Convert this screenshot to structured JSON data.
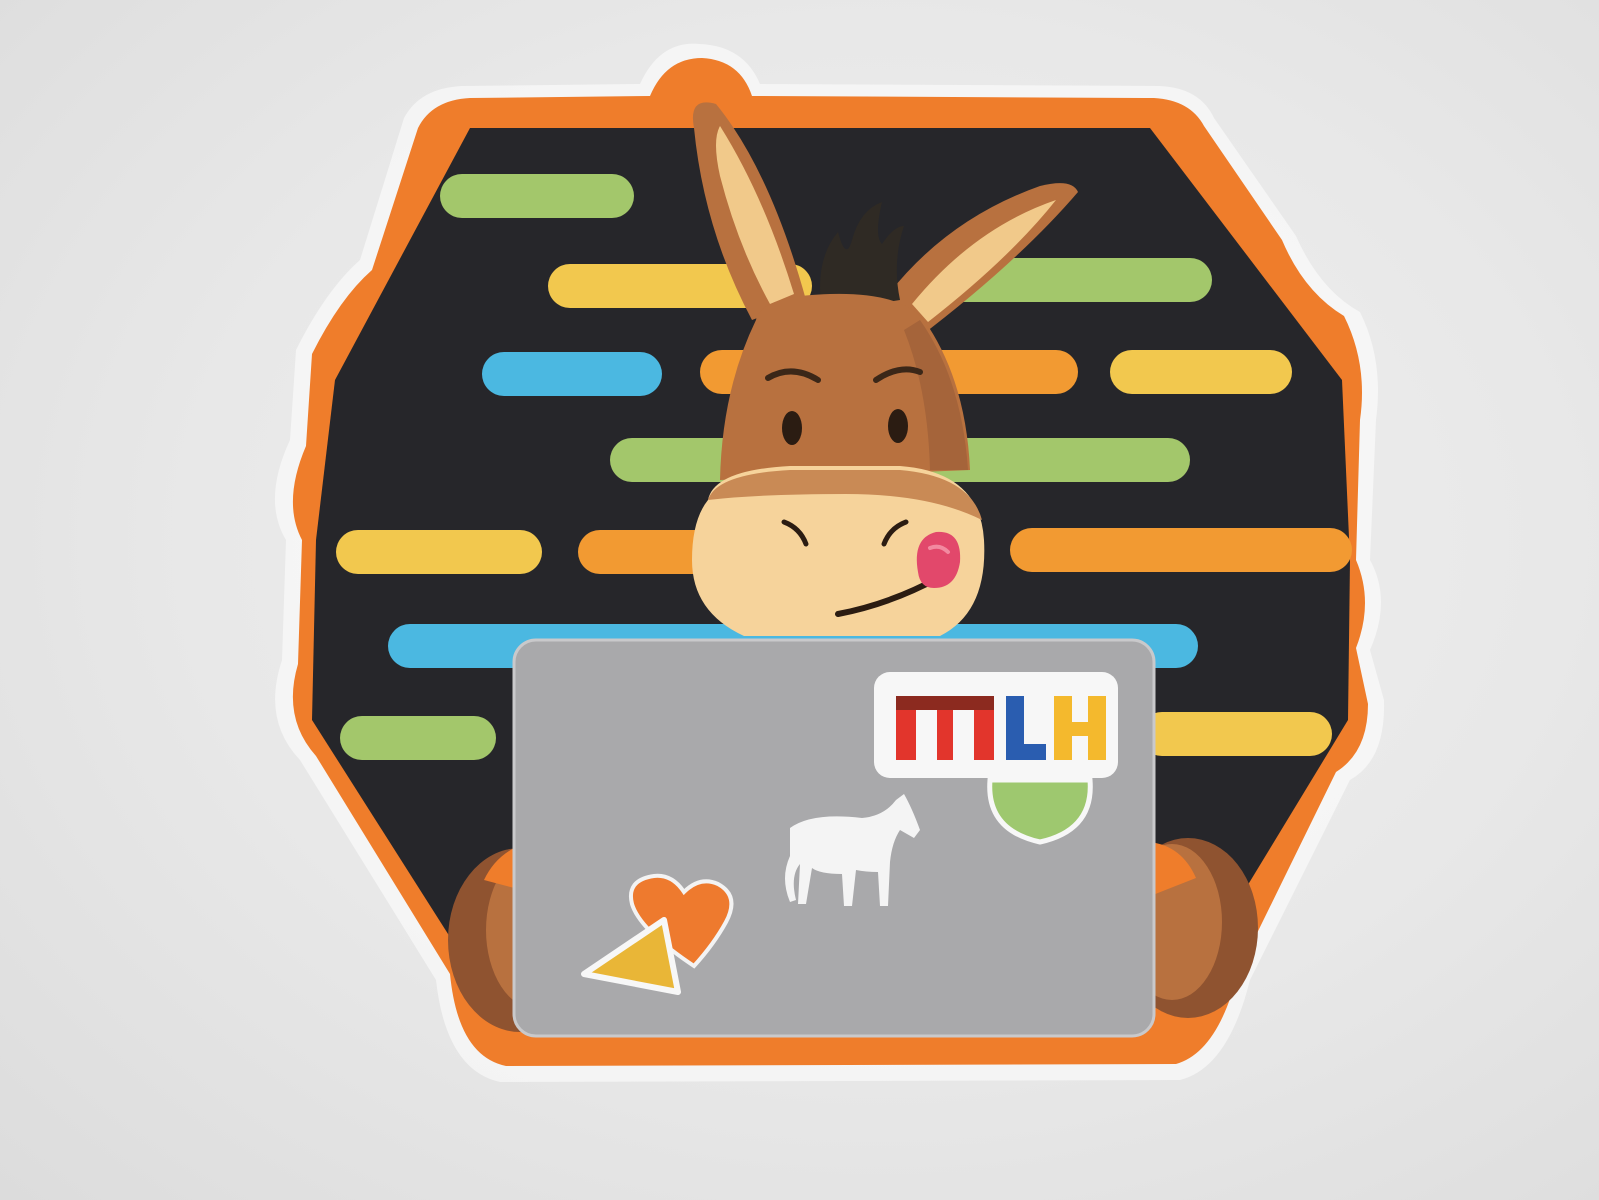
{
  "sticker": {
    "subject": "donkey-mascot-with-laptop",
    "laptop_sticker_text": "MLH",
    "laptop_sticker_letters": [
      "M",
      "L",
      "H"
    ]
  },
  "colors": {
    "paper_background": "#e9e9e9",
    "border_orange": "#ef7d2b",
    "panel_black": "#26262a",
    "stripe_green": "#a3c76b",
    "stripe_yellow": "#f2c84e",
    "stripe_blue": "#4bb8e1",
    "stripe_orange": "#f29a32",
    "donkey_fur": "#b8713f",
    "donkey_fur_dark": "#8f5330",
    "donkey_muzzle": "#f6d39b",
    "donkey_mane": "#2f2a24",
    "laptop_gray": "#a9a9ab",
    "mlh_red": "#e2352c",
    "mlh_blue": "#2a5db0",
    "mlh_yellow": "#f4b92d",
    "heart_orange": "#ee7a2e",
    "triangle_yellow": "#e9b637",
    "circle_green": "#9ec86f",
    "horse_white": "#f4f4f4"
  },
  "icons": {
    "laptop_stickers": [
      "mlh-logo-sticker",
      "green-circle-sticker",
      "horse-icon",
      "heart-icon",
      "triangle-icon"
    ]
  }
}
